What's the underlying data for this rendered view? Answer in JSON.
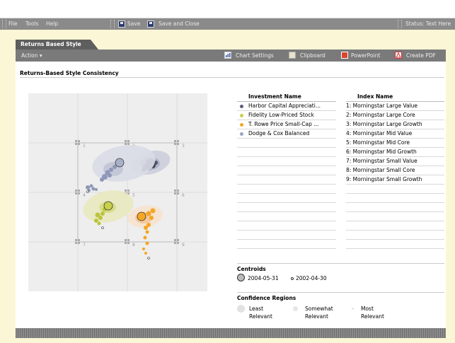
{
  "menubar": {
    "file": "File",
    "tools": "Tools",
    "help": "Help",
    "save": "Save",
    "save_close": "Save and Close",
    "status": "Status: Text Here"
  },
  "tab": {
    "label": "Returns Based Style"
  },
  "toolbar": {
    "action": "Action",
    "chart_settings": "Chart Settings",
    "clipboard": "Clipboard",
    "powerpoint": "PowerPoint",
    "create_pdf": "Create PDF"
  },
  "panel": {
    "title": "Returns-Based Style Consistency"
  },
  "investments": {
    "header": "Investment Name",
    "items": [
      {
        "name": "Harbor Capital Appreciati...",
        "color": "#5a5e7a"
      },
      {
        "name": "Fidelity Low-Priced Stock",
        "color": "#c8cf4a"
      },
      {
        "name": "T. Rowe Price Small-Cap ...",
        "color": "#f5a623"
      },
      {
        "name": "Dodge & Cox Balanced",
        "color": "#9aa3c0"
      }
    ]
  },
  "indexes": {
    "header": "Index Name",
    "items": [
      "1: Morningstar Large Value",
      "2: Morningstar Large Core",
      "3: Morningstar Large Growth",
      "4: Morningstar Mid Value",
      "5: Morningstar Mid Core",
      "6: Morningstar Mid Growth",
      "7: Morningstar Small Value",
      "8: Morningstar Small Core",
      "9: Morningstar Small Growth"
    ]
  },
  "grid_labels": [
    "1",
    "2",
    "3",
    "4",
    "5",
    "6",
    "7",
    "8",
    "9"
  ],
  "centroids": {
    "header": "Centroids",
    "date1": "2004-05-31",
    "date2": "2002-04-30"
  },
  "confidence": {
    "header": "Confidence Regions",
    "least": [
      "Least",
      "Relevant"
    ],
    "somewhat": [
      "Somewhat",
      "Relevant"
    ],
    "most": [
      "Most",
      "Relevant"
    ]
  }
}
